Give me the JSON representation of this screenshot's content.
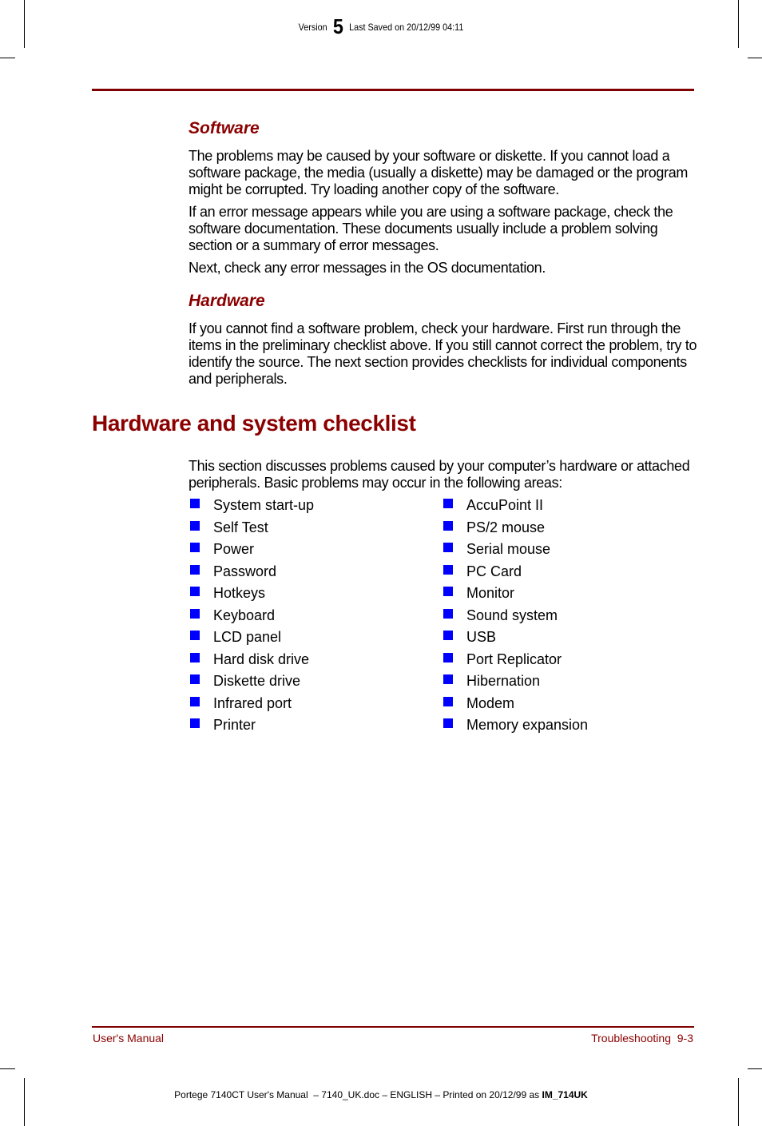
{
  "header": {
    "version_label": "Version",
    "version_number": "5",
    "last_saved": "Last Saved on 20/12/99 04:11"
  },
  "sections": {
    "software": {
      "title": "Software",
      "paragraphs": [
        "The problems may be caused by your software or diskette. If you cannot load a software package, the media (usually a diskette) may be damaged or the program might be corrupted. Try loading another copy of the software.",
        "If an error message appears while you are using a software package, check the software documentation. These documents usually include a problem solving section or a summary of error messages.",
        "Next, check any error messages in the OS documentation."
      ]
    },
    "hardware": {
      "title": "Hardware",
      "paragraphs": [
        "If you cannot find a software problem, check your hardware. First run through the items in the preliminary checklist above. If you still cannot correct the problem, try to identify the source. The next section provides checklists for individual components and peripherals."
      ]
    },
    "checklist": {
      "title": "Hardware and system checklist",
      "intro": "This section discusses problems caused by your computer’s hardware or attached peripherals. Basic problems may occur in the following areas:",
      "bullet_color": "#0000ff",
      "column1": [
        "System start-up",
        "Self Test",
        "Power",
        "Password",
        "Hotkeys",
        "Keyboard",
        "LCD panel",
        "Hard disk drive",
        "Diskette drive",
        "Infrared port",
        "Printer"
      ],
      "column2": [
        "AccuPoint II",
        "PS/2 mouse",
        "Serial mouse",
        "PC Card",
        "Monitor",
        "Sound system",
        "USB",
        "Port Replicator",
        "Hibernation",
        "Modem",
        "Memory expansion"
      ]
    }
  },
  "footer": {
    "left": "User's Manual",
    "right": "Troubleshooting  9-3",
    "print_line_prefix": "Portege 7140CT User's Manual  – 7140_UK.doc – ENGLISH – Printed on 20/12/99 as ",
    "print_line_code": "IM_714UK"
  },
  "colors": {
    "accent": "#8b0000",
    "rule": "#800000"
  }
}
